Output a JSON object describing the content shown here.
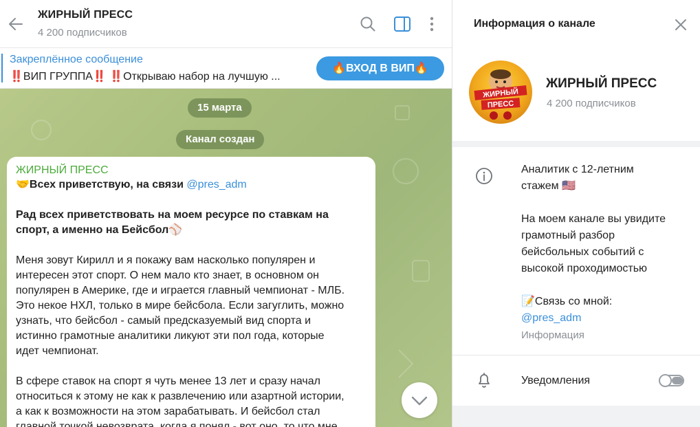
{
  "chat": {
    "title": "ЖИРНЫЙ ПРЕСС",
    "subscribers": "4 200 подписчиков",
    "pinned": {
      "label": "Закреплённое сообщение",
      "text": "‼️ВИП ГРУППА‼️ ‼️Открываю набор на лучшую ..."
    },
    "vip_button": "🔥ВХОД В ВИП🔥",
    "date_label": "15 марта",
    "channel_created": "Канал создан",
    "message": {
      "author": "ЖИРНЫЙ ПРЕСС",
      "greeting_prefix": "🤝Всех приветствую, на связи ",
      "greeting_link": "@pres_adm",
      "bold_line_1": "Рад всех приветствовать на моем ресурсе по ставкам на",
      "bold_line_2": "спорт, а именно на Бейсбол⚾",
      "para1": [
        "Меня зовут Кирилл и я покажу вам насколько популярен и",
        "интересен этот спорт. О нем мало кто знает, в основном он",
        "популярен в Америке, где и играется главный чемпионат - МЛБ.",
        "Это некое НХЛ, только в мире бейсбола. Если загуглить, можно",
        "узнать, что бейсбол - самый предсказуемый вид спорта и",
        "истинно грамотные аналитики ликуют эти пол года, которые",
        "идет чемпионат."
      ],
      "para2": [
        "В сфере ставок на спорт я чуть менее 13 лет и сразу начал",
        "относиться к этому не как к развлечению или азартной истории,",
        "а как к возможности на этом зарабатывать. И бейсбол стал",
        "главной точкой невозврата, когда я понял - вот оно, то что мне"
      ]
    }
  },
  "info": {
    "panel_title": "Информация о канале",
    "name": "ЖИРНЫЙ ПРЕСС",
    "subscribers": "4 200 подписчиков",
    "avatar_text": "ЖИРНЫЙ ПРЕСС",
    "about_lines_1": [
      "Аналитик с 12-летним",
      "стажем 🇺🇸"
    ],
    "about_lines_2": [
      "На моем канале вы увидите",
      "грамотный разбор",
      "бейсбольных событий с",
      "высокой проходимостью"
    ],
    "contact_line": "📝Связь со мной:",
    "contact_link": "@pres_adm",
    "about_label": "Информация",
    "notifications_label": "Уведомления",
    "notifications_enabled": false
  },
  "icons": {
    "back": "arrow-left-icon",
    "search": "search-icon",
    "sidebar": "sidebar-toggle-icon",
    "more": "more-vertical-icon",
    "close": "close-icon",
    "info": "info-icon",
    "bell": "bell-icon",
    "scroll": "chevron-down-icon"
  },
  "colors": {
    "accent": "#3a8fd9",
    "vip_button": "#3b9ae1",
    "author": "#4bab3a",
    "muted": "#8a8f94"
  }
}
